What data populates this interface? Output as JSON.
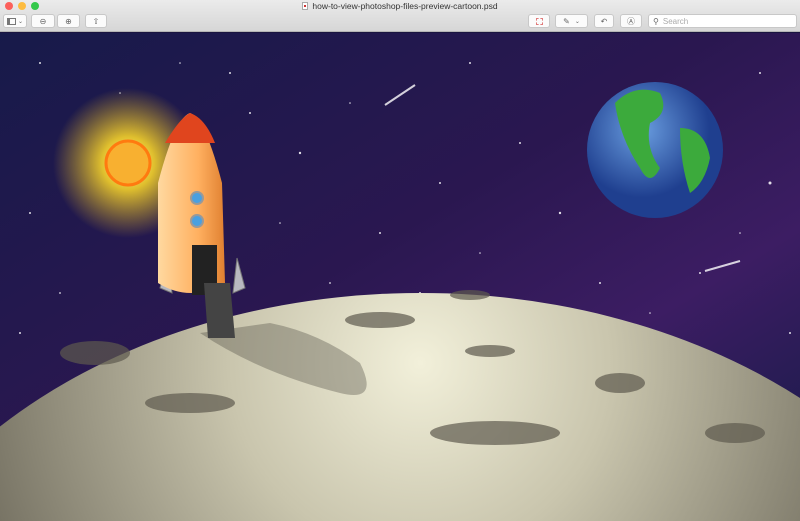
{
  "window": {
    "title": "how-to-view-photoshop-files-preview-cartoon.psd"
  },
  "toolbar": {
    "search_placeholder": "Search"
  },
  "colors": {
    "close": "#fc605b",
    "minimize": "#fdbc40",
    "zoom": "#34c84a"
  }
}
